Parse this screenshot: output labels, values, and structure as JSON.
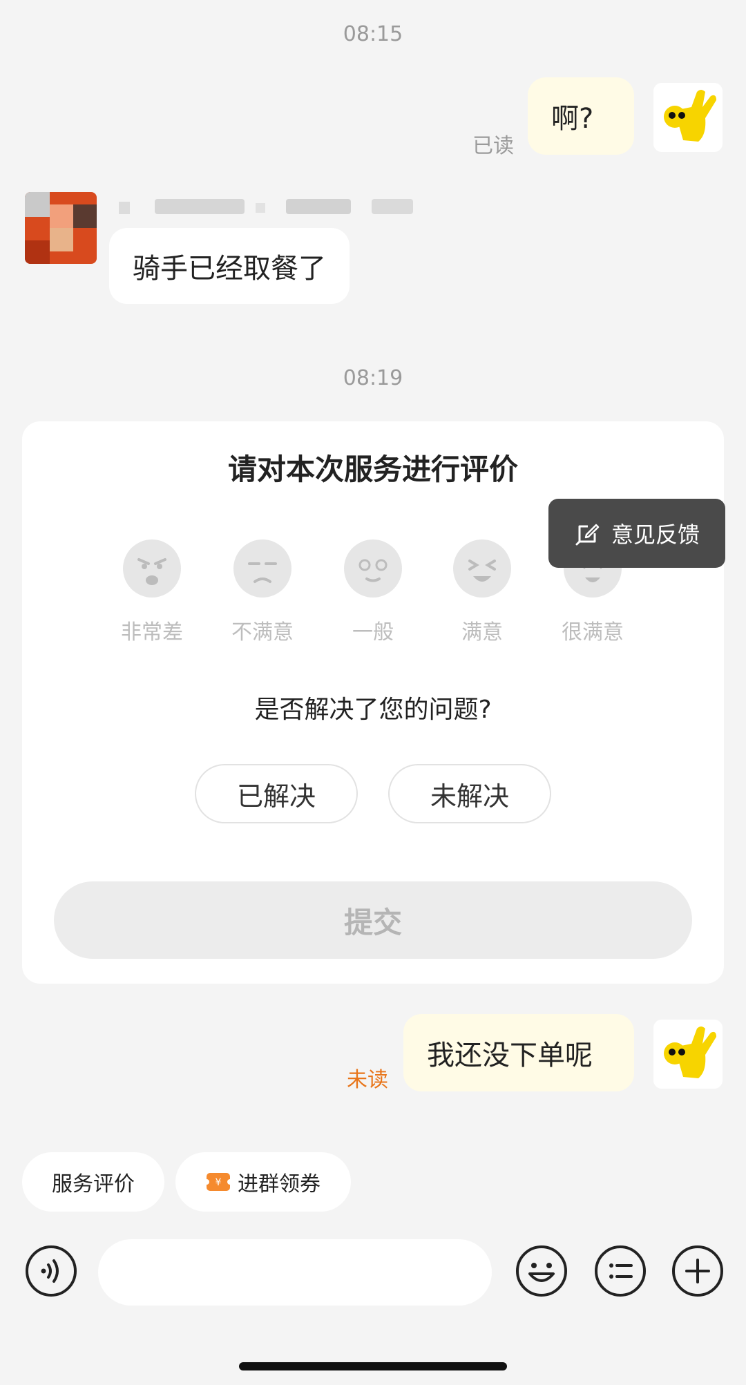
{
  "messages": {
    "time_1": "08:15",
    "me_1": {
      "text": "啊?",
      "status": "已读"
    },
    "other_1": {
      "text": "骑手已经取餐了"
    },
    "time_2": "08:19",
    "me_2": {
      "text": "我还没下单呢",
      "status": "未读"
    }
  },
  "rating_card": {
    "title": "请对本次服务进行评价",
    "ratings": [
      {
        "label": "非常差",
        "icon": "angry-face-icon"
      },
      {
        "label": "不满意",
        "icon": "unhappy-face-icon"
      },
      {
        "label": "一般",
        "icon": "neutral-face-icon"
      },
      {
        "label": "满意",
        "icon": "smile-face-icon"
      },
      {
        "label": "很满意",
        "icon": "love-face-icon"
      }
    ],
    "question": "是否解决了您的问题?",
    "option_resolved": "已解决",
    "option_unresolved": "未解决",
    "submit_label": "提交"
  },
  "tooltip": {
    "label": "意见反馈",
    "icon": "feedback-edit-icon"
  },
  "quick_actions": {
    "service_rating": "服务评价",
    "join_group": "进群领券",
    "join_group_icon": "coupon-icon"
  },
  "input": {
    "placeholder": ""
  },
  "colors": {
    "my_bubble": "#fffbe6",
    "unread": "#e8751a",
    "read": "#9a9a9a",
    "tooltip_bg": "#4a4a4a"
  }
}
